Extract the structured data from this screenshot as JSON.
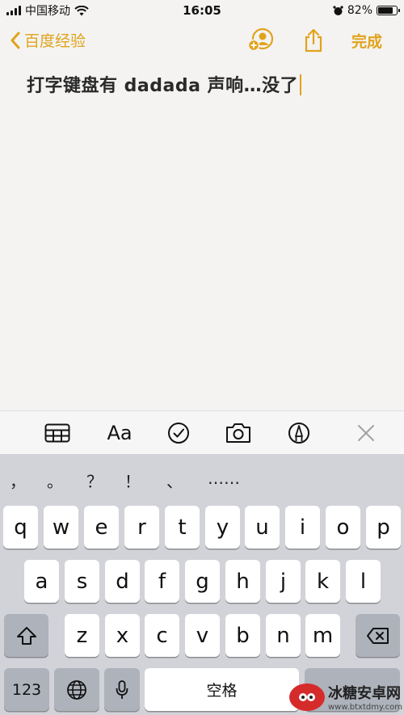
{
  "status_bar": {
    "carrier": "中国移动",
    "time": "16:05",
    "battery_percent": "82%",
    "battery_level": 0.82
  },
  "nav": {
    "back_label": "百度经验",
    "done_label": "完成"
  },
  "note": {
    "text": "打字键盘有 dadada 声响…没了"
  },
  "toolbar": {
    "text_style_label": "Aa",
    "icons": [
      "table-icon",
      "text-style-icon",
      "checklist-icon",
      "camera-icon",
      "markup-icon",
      "close-icon"
    ]
  },
  "keyboard": {
    "candidates": [
      "，",
      "。",
      "？",
      "！",
      "、",
      "……"
    ],
    "row1": [
      "q",
      "w",
      "e",
      "r",
      "t",
      "y",
      "u",
      "i",
      "o",
      "p"
    ],
    "row2": [
      "a",
      "s",
      "d",
      "f",
      "g",
      "h",
      "j",
      "k",
      "l"
    ],
    "row3": [
      "z",
      "x",
      "c",
      "v",
      "b",
      "n",
      "m"
    ],
    "numbers_label": "123",
    "space_label": "空格"
  },
  "watermark": {
    "name": "冰糖安卓网",
    "url": "www.btxtdmy.com"
  },
  "colors": {
    "accent": "#e0a31c",
    "note_background": "#f4f3f1",
    "keyboard_background": "#d1d3d9"
  }
}
